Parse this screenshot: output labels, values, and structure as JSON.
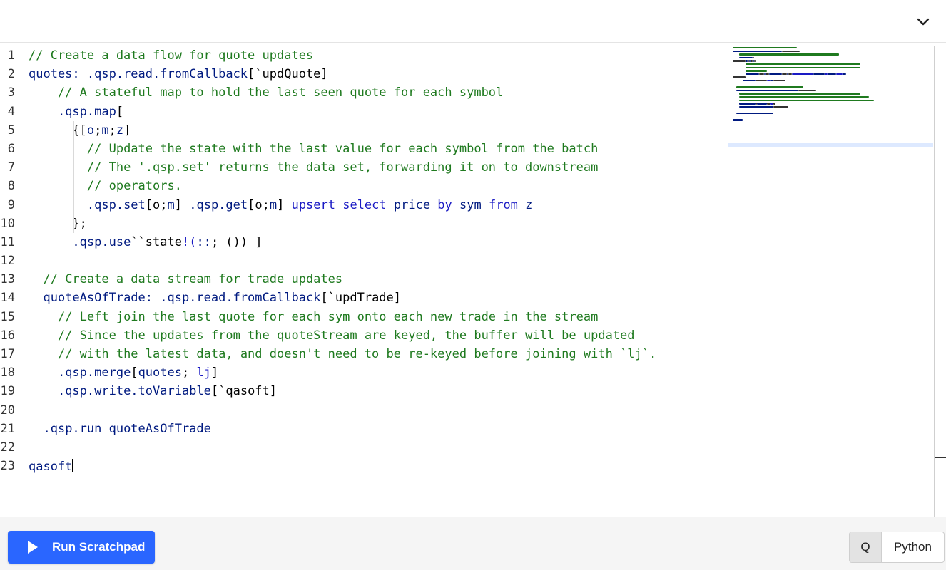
{
  "editor": {
    "line_numbers": [
      "1",
      "2",
      "3",
      "4",
      "5",
      "6",
      "7",
      "8",
      "9",
      "10",
      "11",
      "12",
      "13",
      "14",
      "15",
      "16",
      "17",
      "18",
      "19",
      "20",
      "21",
      "22",
      "23"
    ],
    "lines": [
      [
        {
          "c": "cm",
          "t": "// Create a data flow for quote updates"
        }
      ],
      [
        {
          "c": "fn",
          "t": "quotes: .qsp.read.fromCallback"
        },
        {
          "c": "",
          "t": "[`updQuote]"
        }
      ],
      [
        {
          "c": "",
          "t": "    "
        },
        {
          "c": "cm",
          "t": "// A stateful map to hold the last seen quote for each symbol"
        }
      ],
      [
        {
          "c": "",
          "t": "    "
        },
        {
          "c": "fn",
          "t": ".qsp.map"
        },
        {
          "c": "",
          "t": "["
        }
      ],
      [
        {
          "c": "",
          "t": "      {["
        },
        {
          "c": "fn",
          "t": "o"
        },
        {
          "c": "",
          "t": ";"
        },
        {
          "c": "fn",
          "t": "m"
        },
        {
          "c": "",
          "t": ";"
        },
        {
          "c": "fn",
          "t": "z"
        },
        {
          "c": "",
          "t": "]"
        }
      ],
      [
        {
          "c": "",
          "t": "        "
        },
        {
          "c": "cm",
          "t": "// Update the state with the last value for each symbol from the batch"
        }
      ],
      [
        {
          "c": "",
          "t": "        "
        },
        {
          "c": "cm",
          "t": "// The '.qsp.set' returns the data set, forwarding it on to downstream"
        }
      ],
      [
        {
          "c": "",
          "t": "        "
        },
        {
          "c": "cm",
          "t": "// operators."
        }
      ],
      [
        {
          "c": "",
          "t": "        "
        },
        {
          "c": "fn",
          "t": ".qsp.set"
        },
        {
          "c": "",
          "t": "[o;"
        },
        {
          "c": "fn",
          "t": "m"
        },
        {
          "c": "",
          "t": "] "
        },
        {
          "c": "fn",
          "t": ".qsp.get"
        },
        {
          "c": "",
          "t": "[o;"
        },
        {
          "c": "fn",
          "t": "m"
        },
        {
          "c": "",
          "t": "] "
        },
        {
          "c": "kw",
          "t": "upsert select"
        },
        {
          "c": "fn",
          "t": " price "
        },
        {
          "c": "kw",
          "t": "by"
        },
        {
          "c": "fn",
          "t": " sym "
        },
        {
          "c": "kw",
          "t": "from"
        },
        {
          "c": "fn",
          "t": " z"
        }
      ],
      [
        {
          "c": "",
          "t": "      };"
        }
      ],
      [
        {
          "c": "",
          "t": "      "
        },
        {
          "c": "fn",
          "t": ".qsp.use"
        },
        {
          "c": "",
          "t": "``state"
        },
        {
          "c": "kw",
          "t": "!("
        },
        {
          "c": "fn",
          "t": "::"
        },
        {
          "c": "",
          "t": "; ()) ]"
        }
      ],
      [
        {
          "c": "",
          "t": ""
        }
      ],
      [
        {
          "c": "",
          "t": "  "
        },
        {
          "c": "cm",
          "t": "// Create a data stream for trade updates"
        }
      ],
      [
        {
          "c": "",
          "t": "  "
        },
        {
          "c": "fn",
          "t": "quoteAsOfTrade: .qsp.read.fromCallback"
        },
        {
          "c": "",
          "t": "[`updTrade]"
        }
      ],
      [
        {
          "c": "",
          "t": "    "
        },
        {
          "c": "cm",
          "t": "// Left join the last quote for each sym onto each new trade in the stream"
        }
      ],
      [
        {
          "c": "",
          "t": "    "
        },
        {
          "c": "cm",
          "t": "// Since the updates from the quoteStream are keyed, the buffer will be updated"
        }
      ],
      [
        {
          "c": "",
          "t": "    "
        },
        {
          "c": "cm",
          "t": "// with the latest data, and doesn't need to be re-keyed before joining with `lj`."
        }
      ],
      [
        {
          "c": "",
          "t": "    "
        },
        {
          "c": "fn",
          "t": ".qsp.merge"
        },
        {
          "c": "",
          "t": "["
        },
        {
          "c": "fn",
          "t": "quotes"
        },
        {
          "c": "",
          "t": "; "
        },
        {
          "c": "kw",
          "t": "lj"
        },
        {
          "c": "",
          "t": "]"
        }
      ],
      [
        {
          "c": "",
          "t": "    "
        },
        {
          "c": "fn",
          "t": ".qsp.write.toVariable"
        },
        {
          "c": "",
          "t": "[`qasoft]"
        }
      ],
      [
        {
          "c": "",
          "t": ""
        }
      ],
      [
        {
          "c": "",
          "t": "  "
        },
        {
          "c": "fn",
          "t": ".qsp.run quoteAsOfTrade"
        }
      ],
      [
        {
          "c": "",
          "t": ""
        }
      ],
      [
        {
          "c": "fn",
          "t": "qasoft"
        }
      ]
    ]
  },
  "footer": {
    "run_label": "Run Scratchpad",
    "lang_q": "Q",
    "lang_python": "Python"
  },
  "colors": {
    "accent": "#2a66ff",
    "comment": "#1f7a1f",
    "keyword": "#1a1ac4",
    "identifier": "#001a80"
  },
  "icons": {
    "collapse": "chevron-down-icon",
    "run": "play-icon"
  }
}
